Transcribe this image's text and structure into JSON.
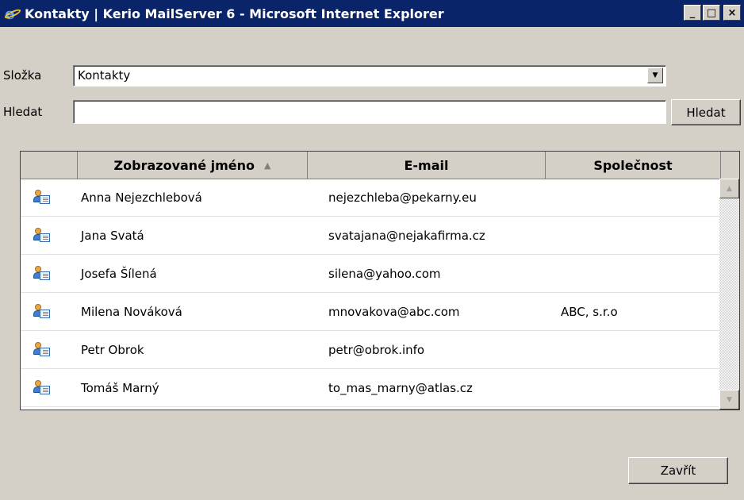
{
  "window": {
    "title": "Kontakty | Kerio MailServer 6 - Microsoft Internet Explorer",
    "minimize_glyph": "_",
    "maximize_glyph": "□",
    "close_glyph": "×"
  },
  "folder": {
    "label": "Složka",
    "value": "Kontakty"
  },
  "search": {
    "label": "Hledat",
    "value": "",
    "placeholder": "",
    "button_label": "Hledat"
  },
  "table": {
    "columns": [
      {
        "label": "Zobrazované jméno",
        "sorted": "ascending"
      },
      {
        "label": "E-mail"
      },
      {
        "label": "Společnost"
      }
    ],
    "rows": [
      {
        "name": "Anna Nejezchlebová",
        "email": "nejezchleba@pekarny.eu",
        "company": ""
      },
      {
        "name": "Jana Svatá",
        "email": "svatajana@nejakafirma.cz",
        "company": ""
      },
      {
        "name": "Josefa Šílená",
        "email": "silena@yahoo.com",
        "company": ""
      },
      {
        "name": "Milena Nováková",
        "email": "mnovakova@abc.com",
        "company": "ABC, s.r.o"
      },
      {
        "name": "Petr Obrok",
        "email": "petr@obrok.info",
        "company": ""
      },
      {
        "name": "Tomáš Marný",
        "email": "to_mas_marny@atlas.cz",
        "company": ""
      }
    ],
    "row_icon": "contact-card-icon"
  },
  "close_button": {
    "label": "Zavřít"
  },
  "colors": {
    "titlebar": "#0a246a",
    "window_bg": "#d4d0c8"
  }
}
